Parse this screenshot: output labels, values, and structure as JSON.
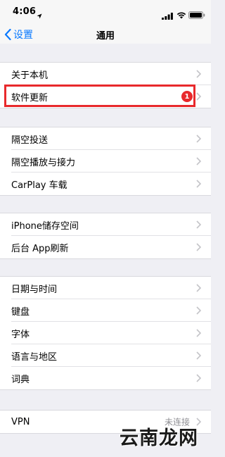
{
  "status_bar": {
    "time": "4:06",
    "icons": [
      "location-icon",
      "signal-icon",
      "wifi-icon",
      "battery-icon"
    ]
  },
  "nav": {
    "back_label": "设置",
    "title": "通用",
    "accent_color": "#0a7aff"
  },
  "groups": [
    {
      "rows": [
        {
          "label": "关于本机"
        },
        {
          "label": "软件更新",
          "badge": "1",
          "highlighted": true
        }
      ]
    },
    {
      "rows": [
        {
          "label": "隔空投送"
        },
        {
          "label": "隔空播放与接力"
        },
        {
          "label": "CarPlay 车载"
        }
      ]
    },
    {
      "rows": [
        {
          "label": "iPhone储存空间"
        },
        {
          "label": "后台 App刷新"
        }
      ]
    },
    {
      "rows": [
        {
          "label": "日期与时间"
        },
        {
          "label": "键盘"
        },
        {
          "label": "字体"
        },
        {
          "label": "语言与地区"
        },
        {
          "label": "词典"
        }
      ]
    },
    {
      "rows": [
        {
          "label": "VPN",
          "detail": "未连接"
        }
      ]
    }
  ],
  "highlight_color": "#e8292c",
  "watermark": "云南龙网"
}
